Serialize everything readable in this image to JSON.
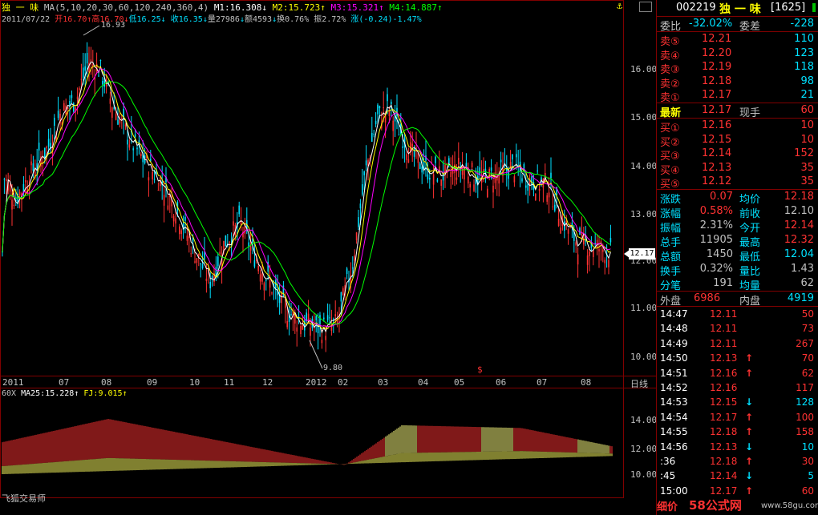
{
  "header": {
    "stock_name": "独 一 味",
    "ma_label": "MA(5,10,20,30,60,120,240,360,4)",
    "m1": "M1:16.308",
    "m1_arrow": "↓",
    "m2": "M2:15.723",
    "m2_arrow": "↑",
    "m3": "M3:15.321",
    "m3_arrow": "↑",
    "m4": "M4:14.887",
    "m4_arrow": "↑"
  },
  "infobar": {
    "date": "2011/07/22",
    "open": "开16.70",
    "open_arrow": "↑",
    "high": "高16.70",
    "high_arrow": "↓",
    "low": "低16.25",
    "low_arrow": "↓",
    "close": "收16.35",
    "close_arrow": "↓",
    "volume": "量27986",
    "volume_arrow": "↓",
    "amount": "额4593",
    "amount_arrow": "↓",
    "turnover": "换0.76%",
    "amplitude": "振2.72%",
    "change": "涨(-0.24)-1.47%"
  },
  "main_chart": {
    "price_axis": [
      "16.00",
      "15.00",
      "14.00",
      "13.00",
      "12.00",
      "11.00",
      "10.00"
    ],
    "high_marker": "16.93",
    "low_marker": "9.80",
    "current_price_tag": "12.17",
    "time_axis": [
      "2011",
      "07",
      "08",
      "09",
      "10",
      "11",
      "12",
      "2012",
      "02",
      "03",
      "04",
      "05",
      "06",
      "07",
      "08"
    ],
    "period_label": "日线",
    "dividend_marker": "$",
    "colors": {
      "up": "#ff3232",
      "down": "#00e0ff",
      "ma1": "#ffffff",
      "ma2": "#ffff00",
      "ma3": "#ff00ff",
      "ma4": "#00ff00"
    }
  },
  "sub_chart": {
    "label": "60X",
    "ma25": "MA25:15.228",
    "ma25_arrow": "↑",
    "fj": "FJ:9.015",
    "fj_arrow": "↑",
    "axis": [
      "14.00",
      "12.00",
      "10.00"
    ],
    "watermark": "飞狐交易师"
  },
  "quote_panel": {
    "code": "002219",
    "name": "独 一 味",
    "name_code": "[1625]",
    "weibi_label": "委比",
    "weibi_value": "-32.02%",
    "weicha_label": "委差",
    "weicha_value": "-228",
    "sells": [
      {
        "label": "卖⑤",
        "price": "12.21",
        "vol": "110"
      },
      {
        "label": "卖④",
        "price": "12.20",
        "vol": "123"
      },
      {
        "label": "卖③",
        "price": "12.19",
        "vol": "118"
      },
      {
        "label": "卖②",
        "price": "12.18",
        "vol": "98"
      },
      {
        "label": "卖①",
        "price": "12.17",
        "vol": "21"
      }
    ],
    "latest_label": "最新",
    "latest_price": "12.17",
    "current_hand_label": "现手",
    "current_hand": "60",
    "buys": [
      {
        "label": "买①",
        "price": "12.16",
        "vol": "10"
      },
      {
        "label": "买②",
        "price": "12.15",
        "vol": "10"
      },
      {
        "label": "买③",
        "price": "12.14",
        "vol": "152"
      },
      {
        "label": "买④",
        "price": "12.13",
        "vol": "35"
      },
      {
        "label": "买⑤",
        "price": "12.12",
        "vol": "35"
      }
    ],
    "stats": [
      {
        "l1": "涨跌",
        "v1": "0.07",
        "l2": "均价",
        "v2": "12.18"
      },
      {
        "l1": "涨幅",
        "v1": "0.58%",
        "l2": "前收",
        "v2": "12.10"
      },
      {
        "l1": "振幅",
        "v1": "2.31%",
        "l2": "今开",
        "v2": "12.14"
      },
      {
        "l1": "总手",
        "v1": "11905",
        "l2": "最高",
        "v2": "12.32"
      },
      {
        "l1": "总额",
        "v1": "1450",
        "l2": "最低",
        "v2": "12.04"
      },
      {
        "l1": "换手",
        "v1": "0.32%",
        "l2": "量比",
        "v2": "1.43"
      },
      {
        "l1": "分笔",
        "v1": "191",
        "l2": "均量",
        "v2": "62"
      }
    ],
    "outer_label": "外盘",
    "outer_value": "6986",
    "inner_label": "内盘",
    "inner_value": "4919",
    "ticks": [
      {
        "time": "14:47",
        "price": "12.11",
        "arrow": "",
        "vol": "50"
      },
      {
        "time": "14:48",
        "price": "12.11",
        "arrow": "",
        "vol": "73"
      },
      {
        "time": "14:49",
        "price": "12.11",
        "arrow": "",
        "vol": "267"
      },
      {
        "time": "14:50",
        "price": "12.13",
        "arrow": "↑",
        "vol": "70"
      },
      {
        "time": "14:51",
        "price": "12.16",
        "arrow": "↑",
        "vol": "62"
      },
      {
        "time": "14:52",
        "price": "12.16",
        "arrow": "",
        "vol": "117"
      },
      {
        "time": "14:53",
        "price": "12.15",
        "arrow": "↓",
        "vol": "128"
      },
      {
        "time": "14:54",
        "price": "12.17",
        "arrow": "↑",
        "vol": "100"
      },
      {
        "time": "14:55",
        "price": "12.18",
        "arrow": "↑",
        "vol": "158"
      },
      {
        "time": "14:56",
        "price": "12.13",
        "arrow": "↓",
        "vol": "10"
      },
      {
        "time": ":36",
        "price": "12.18",
        "arrow": "↑",
        "vol": "30"
      },
      {
        "time": ":45",
        "price": "12.14",
        "arrow": "↓",
        "vol": "5"
      },
      {
        "time": "15:00",
        "price": "12.17",
        "arrow": "↑",
        "vol": "60"
      }
    ],
    "footer_tab": "细价",
    "watermark": "58公式网",
    "watermark_url": "www.58gu.com"
  }
}
